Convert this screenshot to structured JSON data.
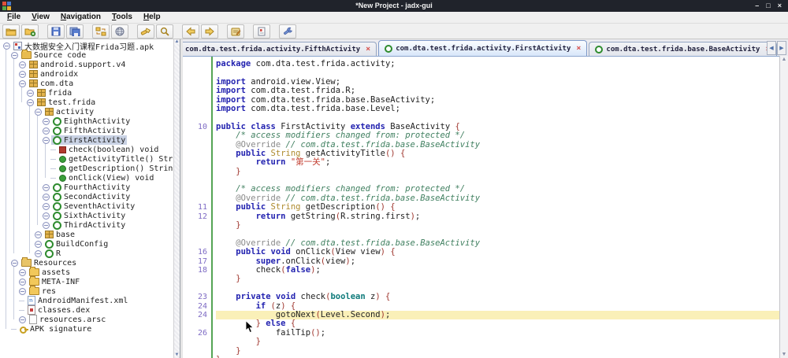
{
  "window": {
    "title": "*New Project - jadx-gui",
    "controls": [
      {
        "name": "minimize",
        "glyph": "–"
      },
      {
        "name": "maximize",
        "glyph": "□"
      },
      {
        "name": "close",
        "glyph": "×"
      }
    ]
  },
  "menu": {
    "items": [
      {
        "label": "File"
      },
      {
        "label": "View"
      },
      {
        "label": "Navigation"
      },
      {
        "label": "Tools"
      },
      {
        "label": "Help"
      }
    ]
  },
  "toolbar": {
    "buttons": [
      {
        "name": "open-file-button",
        "icon": "folder-open-icon"
      },
      {
        "name": "add-files-button",
        "icon": "folder-add-icon"
      },
      {
        "name": "save-project-button",
        "icon": "save-icon"
      },
      {
        "name": "save-all-button",
        "icon": "save-all-icon"
      },
      {
        "name": "reload-button",
        "icon": "reload-icon"
      },
      {
        "name": "deobfuscation-button",
        "icon": "globe-icon"
      },
      {
        "name": "text-search-button",
        "icon": "flashlight-icon"
      },
      {
        "name": "class-search-button",
        "icon": "magnifier-icon"
      },
      {
        "name": "back-button",
        "icon": "arrow-left-icon"
      },
      {
        "name": "forward-button",
        "icon": "arrow-right-icon"
      },
      {
        "name": "open-log-button",
        "icon": "log-icon"
      },
      {
        "name": "report-button",
        "icon": "report-icon"
      },
      {
        "name": "settings-button",
        "icon": "wrench-icon"
      }
    ],
    "gap_before": [
      2,
      4,
      6,
      8,
      10,
      11,
      12
    ]
  },
  "tree": {
    "items": [
      {
        "label": "大数据安全入门课程Frida习题.apk",
        "level": 0,
        "icon": "apk-icon",
        "handle": true
      },
      {
        "label": "Source code",
        "level": 1,
        "icon": "source-folder-icon",
        "handle": true
      },
      {
        "label": "android.support.v4",
        "level": 2,
        "icon": "package-icon",
        "handle": true
      },
      {
        "label": "androidx",
        "level": 2,
        "icon": "package-icon",
        "handle": true
      },
      {
        "label": "com.dta",
        "level": 2,
        "icon": "package-icon",
        "handle": true
      },
      {
        "label": "frida",
        "level": 3,
        "icon": "package-icon",
        "handle": true
      },
      {
        "label": "test.frida",
        "level": 3,
        "icon": "package-icon",
        "handle": true
      },
      {
        "label": "activity",
        "level": 4,
        "icon": "package-icon",
        "handle": true
      },
      {
        "label": "EighthActivity",
        "level": 5,
        "icon": "class-icon",
        "handle": true
      },
      {
        "label": "FifthActivity",
        "level": 5,
        "icon": "class-icon",
        "handle": true
      },
      {
        "label": "FirstActivity",
        "level": 5,
        "icon": "class-icon",
        "handle": true,
        "selected": true
      },
      {
        "label": "check(boolean) void",
        "level": 6,
        "icon": "method-private-icon"
      },
      {
        "label": "getActivityTitle() String",
        "level": 6,
        "icon": "method-public-icon"
      },
      {
        "label": "getDescription() String",
        "level": 6,
        "icon": "method-public-icon"
      },
      {
        "label": "onClick(View) void",
        "level": 6,
        "icon": "method-public-icon"
      },
      {
        "label": "FourthActivity",
        "level": 5,
        "icon": "class-icon",
        "handle": true
      },
      {
        "label": "SecondActivity",
        "level": 5,
        "icon": "class-icon",
        "handle": true
      },
      {
        "label": "SeventhActivity",
        "level": 5,
        "icon": "class-icon",
        "handle": true
      },
      {
        "label": "SixthActivity",
        "level": 5,
        "icon": "class-icon",
        "handle": true
      },
      {
        "label": "ThirdActivity",
        "level": 5,
        "icon": "class-icon",
        "handle": true
      },
      {
        "label": "base",
        "level": 4,
        "icon": "package-icon",
        "handle": true
      },
      {
        "label": "BuildConfig",
        "level": 4,
        "icon": "class-icon",
        "handle": true
      },
      {
        "label": "R",
        "level": 4,
        "icon": "class-icon",
        "handle": true
      },
      {
        "label": "Resources",
        "level": 1,
        "icon": "resources-folder-icon",
        "handle": true
      },
      {
        "label": "assets",
        "level": 2,
        "icon": "folder-icon",
        "handle": true
      },
      {
        "label": "META-INF",
        "level": 2,
        "icon": "folder-icon",
        "handle": true
      },
      {
        "label": "res",
        "level": 2,
        "icon": "folder-icon",
        "handle": true
      },
      {
        "label": "AndroidManifest.xml",
        "level": 2,
        "icon": "xml-file-icon"
      },
      {
        "label": "classes.dex",
        "level": 2,
        "icon": "dex-file-icon"
      },
      {
        "label": "resources.arsc",
        "level": 2,
        "icon": "file-icon",
        "handle": true
      },
      {
        "label": "APK signature",
        "level": 1,
        "icon": "key-icon"
      }
    ]
  },
  "tabs": [
    {
      "label": "com.dta.test.frida.activity.FifthActivity",
      "icon": false,
      "selected": false
    },
    {
      "label": "com.dta.test.frida.activity.FirstActivity",
      "icon": true,
      "selected": true
    },
    {
      "label": "com.dta.test.frida.base.BaseActivity",
      "icon": true,
      "selected": false
    }
  ],
  "editor": {
    "lines": [
      {
        "g": "",
        "t": [
          [
            "kw",
            "package"
          ],
          [
            "pl",
            " com.dta.test.frida.activity;"
          ]
        ]
      },
      {
        "g": "",
        "t": []
      },
      {
        "g": "",
        "t": [
          [
            "kw",
            "import"
          ],
          [
            "pl",
            " android.view.View;"
          ]
        ]
      },
      {
        "g": "",
        "t": [
          [
            "kw",
            "import"
          ],
          [
            "pl",
            " com.dta.test.frida.R;"
          ]
        ]
      },
      {
        "g": "",
        "t": [
          [
            "kw",
            "import"
          ],
          [
            "pl",
            " com.dta.test.frida.base.BaseActivity;"
          ]
        ]
      },
      {
        "g": "",
        "t": [
          [
            "kw",
            "import"
          ],
          [
            "pl",
            " com.dta.test.frida.base.Level;"
          ]
        ]
      },
      {
        "g": "",
        "t": []
      },
      {
        "g": "10",
        "t": [
          [
            "kw",
            "public"
          ],
          [
            "pl",
            " "
          ],
          [
            "kw",
            "class"
          ],
          [
            "pl",
            " FirstActivity "
          ],
          [
            "kw",
            "extends"
          ],
          [
            "pl",
            " BaseActivity "
          ],
          [
            "pu",
            "{"
          ]
        ]
      },
      {
        "g": "",
        "t": [
          [
            "cm",
            "    /* access modifiers changed from: protected */"
          ]
        ]
      },
      {
        "g": "",
        "t": [
          [
            "an",
            "    @Override "
          ],
          [
            "cm",
            "// com.dta.test.frida.base.BaseActivity"
          ]
        ]
      },
      {
        "g": "",
        "t": [
          [
            "kw",
            "    public"
          ],
          [
            "pl",
            " "
          ],
          [
            "ty",
            "String"
          ],
          [
            "pl",
            " getActivityTitle"
          ],
          [
            "pu",
            "()"
          ],
          [
            "pl",
            " "
          ],
          [
            "pu",
            "{"
          ]
        ]
      },
      {
        "g": "",
        "t": [
          [
            "kw",
            "        return"
          ],
          [
            "pl",
            " "
          ],
          [
            "st",
            "\"第一关\""
          ],
          [
            "pl",
            ";"
          ]
        ]
      },
      {
        "g": "",
        "t": [
          [
            "pu",
            "    }"
          ]
        ]
      },
      {
        "g": "",
        "t": []
      },
      {
        "g": "",
        "t": [
          [
            "cm",
            "    /* access modifiers changed from: protected */"
          ]
        ]
      },
      {
        "g": "",
        "t": [
          [
            "an",
            "    @Override "
          ],
          [
            "cm",
            "// com.dta.test.frida.base.BaseActivity"
          ]
        ]
      },
      {
        "g": "11",
        "t": [
          [
            "kw",
            "    public"
          ],
          [
            "pl",
            " "
          ],
          [
            "ty",
            "String"
          ],
          [
            "pl",
            " getDescription"
          ],
          [
            "pu",
            "()"
          ],
          [
            "pl",
            " "
          ],
          [
            "pu",
            "{"
          ]
        ]
      },
      {
        "g": "12",
        "t": [
          [
            "kw",
            "        return"
          ],
          [
            "pl",
            " getString"
          ],
          [
            "pu",
            "("
          ],
          [
            "pl",
            "R.string.first"
          ],
          [
            "pu",
            ")"
          ],
          [
            "pl",
            ";"
          ]
        ]
      },
      {
        "g": "",
        "t": [
          [
            "pu",
            "    }"
          ]
        ]
      },
      {
        "g": "",
        "t": []
      },
      {
        "g": "",
        "t": [
          [
            "an",
            "    @Override "
          ],
          [
            "cm",
            "// com.dta.test.frida.base.BaseActivity"
          ]
        ]
      },
      {
        "g": "16",
        "t": [
          [
            "kw",
            "    public"
          ],
          [
            "pl",
            " "
          ],
          [
            "kw",
            "void"
          ],
          [
            "pl",
            " onClick"
          ],
          [
            "pu",
            "("
          ],
          [
            "pl",
            "View view"
          ],
          [
            "pu",
            ")"
          ],
          [
            "pl",
            " "
          ],
          [
            "pu",
            "{"
          ]
        ]
      },
      {
        "g": "17",
        "t": [
          [
            "kw",
            "        super"
          ],
          [
            "pl",
            ".onClick"
          ],
          [
            "pu",
            "("
          ],
          [
            "pl",
            "view"
          ],
          [
            "pu",
            ")"
          ],
          [
            "pl",
            ";"
          ]
        ]
      },
      {
        "g": "18",
        "t": [
          [
            "pl",
            "        check"
          ],
          [
            "pu",
            "("
          ],
          [
            "kw",
            "false"
          ],
          [
            "pu",
            ")"
          ],
          [
            "pl",
            ";"
          ]
        ]
      },
      {
        "g": "",
        "t": [
          [
            "pu",
            "    }"
          ]
        ]
      },
      {
        "g": "",
        "t": []
      },
      {
        "g": "23",
        "t": [
          [
            "kw",
            "    private"
          ],
          [
            "pl",
            " "
          ],
          [
            "kw",
            "void"
          ],
          [
            "pl",
            " check"
          ],
          [
            "pu",
            "("
          ],
          [
            "pr",
            "boolean"
          ],
          [
            "pl",
            " z"
          ],
          [
            "pu",
            ")"
          ],
          [
            "pl",
            " "
          ],
          [
            "pu",
            "{"
          ]
        ]
      },
      {
        "g": "24",
        "t": [
          [
            "kw",
            "        if"
          ],
          [
            "pl",
            " "
          ],
          [
            "pu",
            "("
          ],
          [
            "pl",
            "z"
          ],
          [
            "pu",
            ")"
          ],
          [
            "pl",
            " "
          ],
          [
            "pu",
            "{"
          ]
        ]
      },
      {
        "g": "24",
        "hl": true,
        "t": [
          [
            "pl",
            "            gotoNext"
          ],
          [
            "pu",
            "("
          ],
          [
            "pl",
            "Level.Second"
          ],
          [
            "pu",
            ")"
          ],
          [
            "pl",
            ";"
          ]
        ]
      },
      {
        "g": "",
        "t": [
          [
            "pu",
            "        } "
          ],
          [
            "kw",
            "else"
          ],
          [
            "pl",
            " "
          ],
          [
            "pu",
            "{"
          ]
        ]
      },
      {
        "g": "26",
        "t": [
          [
            "pl",
            "            failTip"
          ],
          [
            "pu",
            "()"
          ],
          [
            "pl",
            ";"
          ]
        ]
      },
      {
        "g": "",
        "t": [
          [
            "pu",
            "        }"
          ]
        ]
      },
      {
        "g": "",
        "t": [
          [
            "pu",
            "    }"
          ]
        ]
      },
      {
        "g": "",
        "t": [
          [
            "pu",
            "}"
          ]
        ]
      }
    ]
  },
  "colors": {
    "titlebar_bg": "#20232B",
    "selected_tab_bg": "#D6E5F9",
    "tree_selection_bg": "#C9D2E4",
    "line_highlight": "#FAF0B8",
    "close_red": "#D9534F",
    "class_green": "#2E8B2E",
    "keyword_blue": "#2323B0",
    "comment_green": "#3F7F5F",
    "string_red": "#C0392B",
    "gutter_purple": "#7E6BC4"
  }
}
